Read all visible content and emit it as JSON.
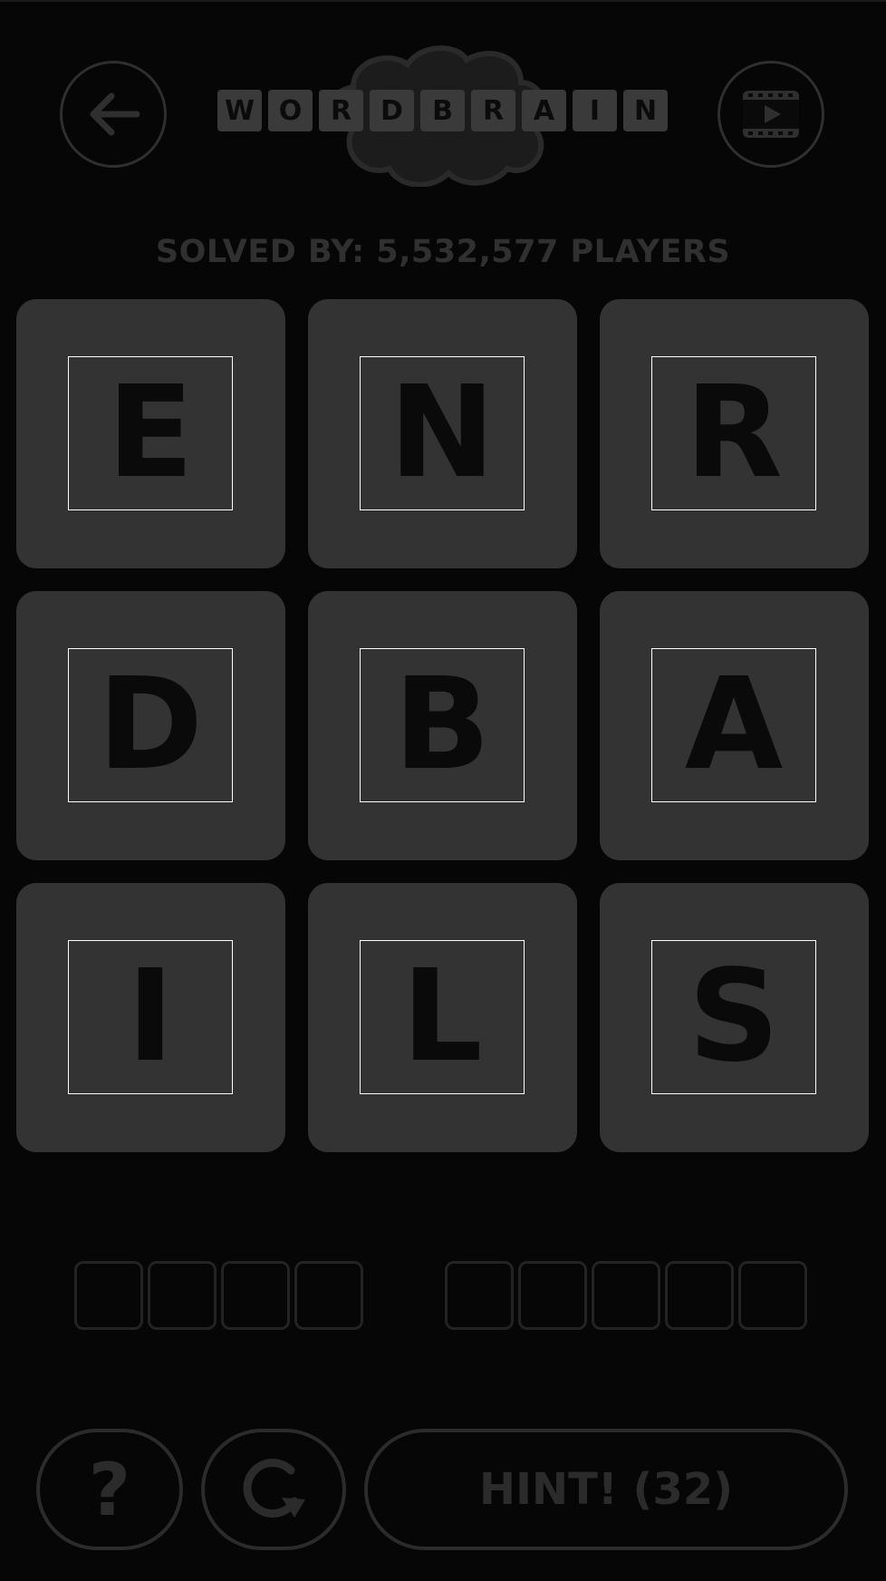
{
  "header": {
    "logo_letters": [
      "W",
      "O",
      "R",
      "D",
      "B",
      "R",
      "A",
      "I",
      "N"
    ],
    "back_icon": "arrow-left-icon",
    "video_icon": "video-play-icon"
  },
  "solved": {
    "text": "SOLVED BY: 5,532,577 PLAYERS"
  },
  "grid": {
    "letters": [
      "E",
      "N",
      "R",
      "D",
      "B",
      "A",
      "I",
      "L",
      "S"
    ]
  },
  "answers": {
    "word_lengths": [
      4,
      5
    ]
  },
  "footer": {
    "help_label": "?",
    "restart_icon": "restart-icon",
    "hint_label": "HINT! (32)"
  },
  "colors": {
    "background": "#060606",
    "tile": "#333333",
    "muted": "#2b2b2b"
  }
}
